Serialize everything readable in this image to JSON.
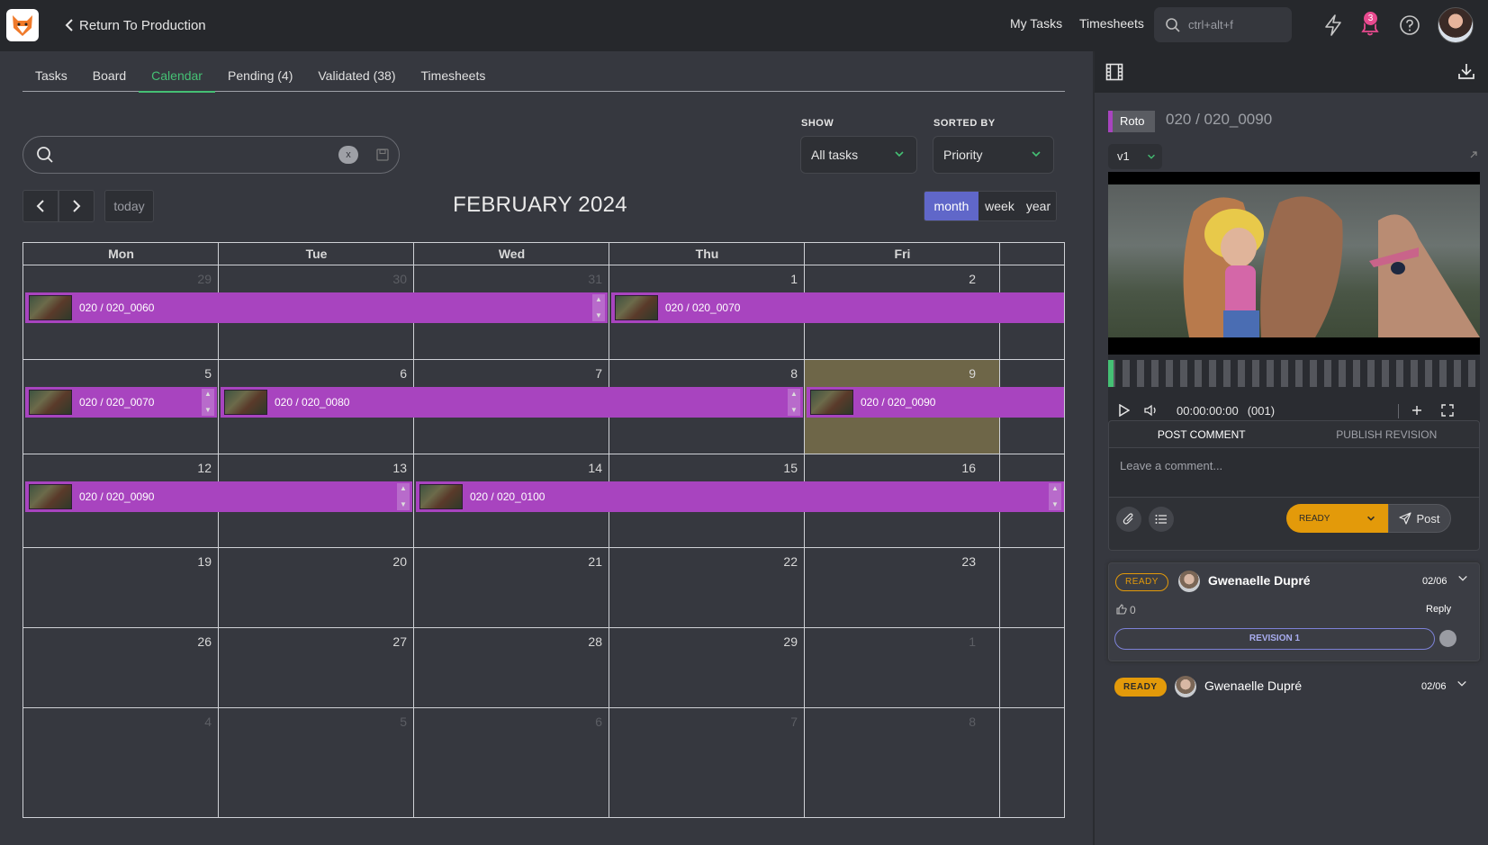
{
  "topbar": {
    "back_label": "Return To Production",
    "links": [
      "My Tasks",
      "Timesheets"
    ],
    "search_placeholder": "ctrl+alt+f",
    "notification_count": "3"
  },
  "tabs": [
    {
      "label": "Tasks"
    },
    {
      "label": "Board"
    },
    {
      "label": "Calendar"
    },
    {
      "label": "Pending (4)"
    },
    {
      "label": "Validated (38)"
    },
    {
      "label": "Timesheets"
    }
  ],
  "filters": {
    "search_clear": "x",
    "show_label": "SHOW",
    "show_value": "All tasks",
    "sorted_label": "SORTED BY",
    "sorted_value": "Priority"
  },
  "calendar": {
    "today_label": "today",
    "title": "FEBRUARY 2024",
    "views": [
      "month",
      "week",
      "year"
    ],
    "active_view": "month",
    "daynames": [
      "Mon",
      "Tue",
      "Wed",
      "Thu",
      "Fri"
    ],
    "weeks": [
      [
        {
          "n": "29",
          "dim": true
        },
        {
          "n": "30",
          "dim": true
        },
        {
          "n": "31",
          "dim": true
        },
        {
          "n": "1"
        },
        {
          "n": "2"
        }
      ],
      [
        {
          "n": "5"
        },
        {
          "n": "6"
        },
        {
          "n": "7"
        },
        {
          "n": "8"
        },
        {
          "n": "9",
          "hl": true
        }
      ],
      [
        {
          "n": "12"
        },
        {
          "n": "13"
        },
        {
          "n": "14"
        },
        {
          "n": "15"
        },
        {
          "n": "16"
        }
      ],
      [
        {
          "n": "19"
        },
        {
          "n": "20"
        },
        {
          "n": "21"
        },
        {
          "n": "22"
        },
        {
          "n": "23"
        }
      ],
      [
        {
          "n": "26"
        },
        {
          "n": "27"
        },
        {
          "n": "28"
        },
        {
          "n": "29"
        },
        {
          "n": "1",
          "dim": true
        }
      ],
      [
        {
          "n": "4",
          "dim": true
        },
        {
          "n": "5",
          "dim": true
        },
        {
          "n": "6",
          "dim": true
        },
        {
          "n": "7",
          "dim": true
        },
        {
          "n": "8",
          "dim": true
        }
      ]
    ],
    "events": [
      {
        "label": "020 / 020_0060",
        "week": 0,
        "start": 0,
        "end": 3
      },
      {
        "label": "020 / 020_0070",
        "week": 0,
        "start": 3,
        "end": 5
      },
      {
        "label": "020 / 020_0070",
        "week": 1,
        "start": 0,
        "end": 1
      },
      {
        "label": "020 / 020_0080",
        "week": 1,
        "start": 1,
        "end": 4
      },
      {
        "label": "020 / 020_0090",
        "week": 1,
        "start": 4,
        "end": 5
      },
      {
        "label": "020 / 020_0090",
        "week": 2,
        "start": 0,
        "end": 2
      },
      {
        "label": "020 / 020_0100",
        "week": 2,
        "start": 2,
        "end": 5
      }
    ]
  },
  "panel": {
    "task_type": "Roto",
    "shot_name": "020 / 020_0090",
    "version": "v1",
    "timecode": "00:00:00:00",
    "frame": "(001)",
    "tab_post": "POST COMMENT",
    "tab_publish": "PUBLISH REVISION",
    "comment_placeholder": "Leave a comment...",
    "status_value": "READY",
    "post_label": "Post",
    "comments": [
      {
        "status": "READY",
        "author": "Gwenaelle Dupré",
        "date": "02/06",
        "likes": "0",
        "reply": "Reply",
        "revision": "REVISION 1"
      },
      {
        "status": "READY",
        "author": "Gwenaelle Dupré",
        "date": "02/06"
      }
    ]
  }
}
